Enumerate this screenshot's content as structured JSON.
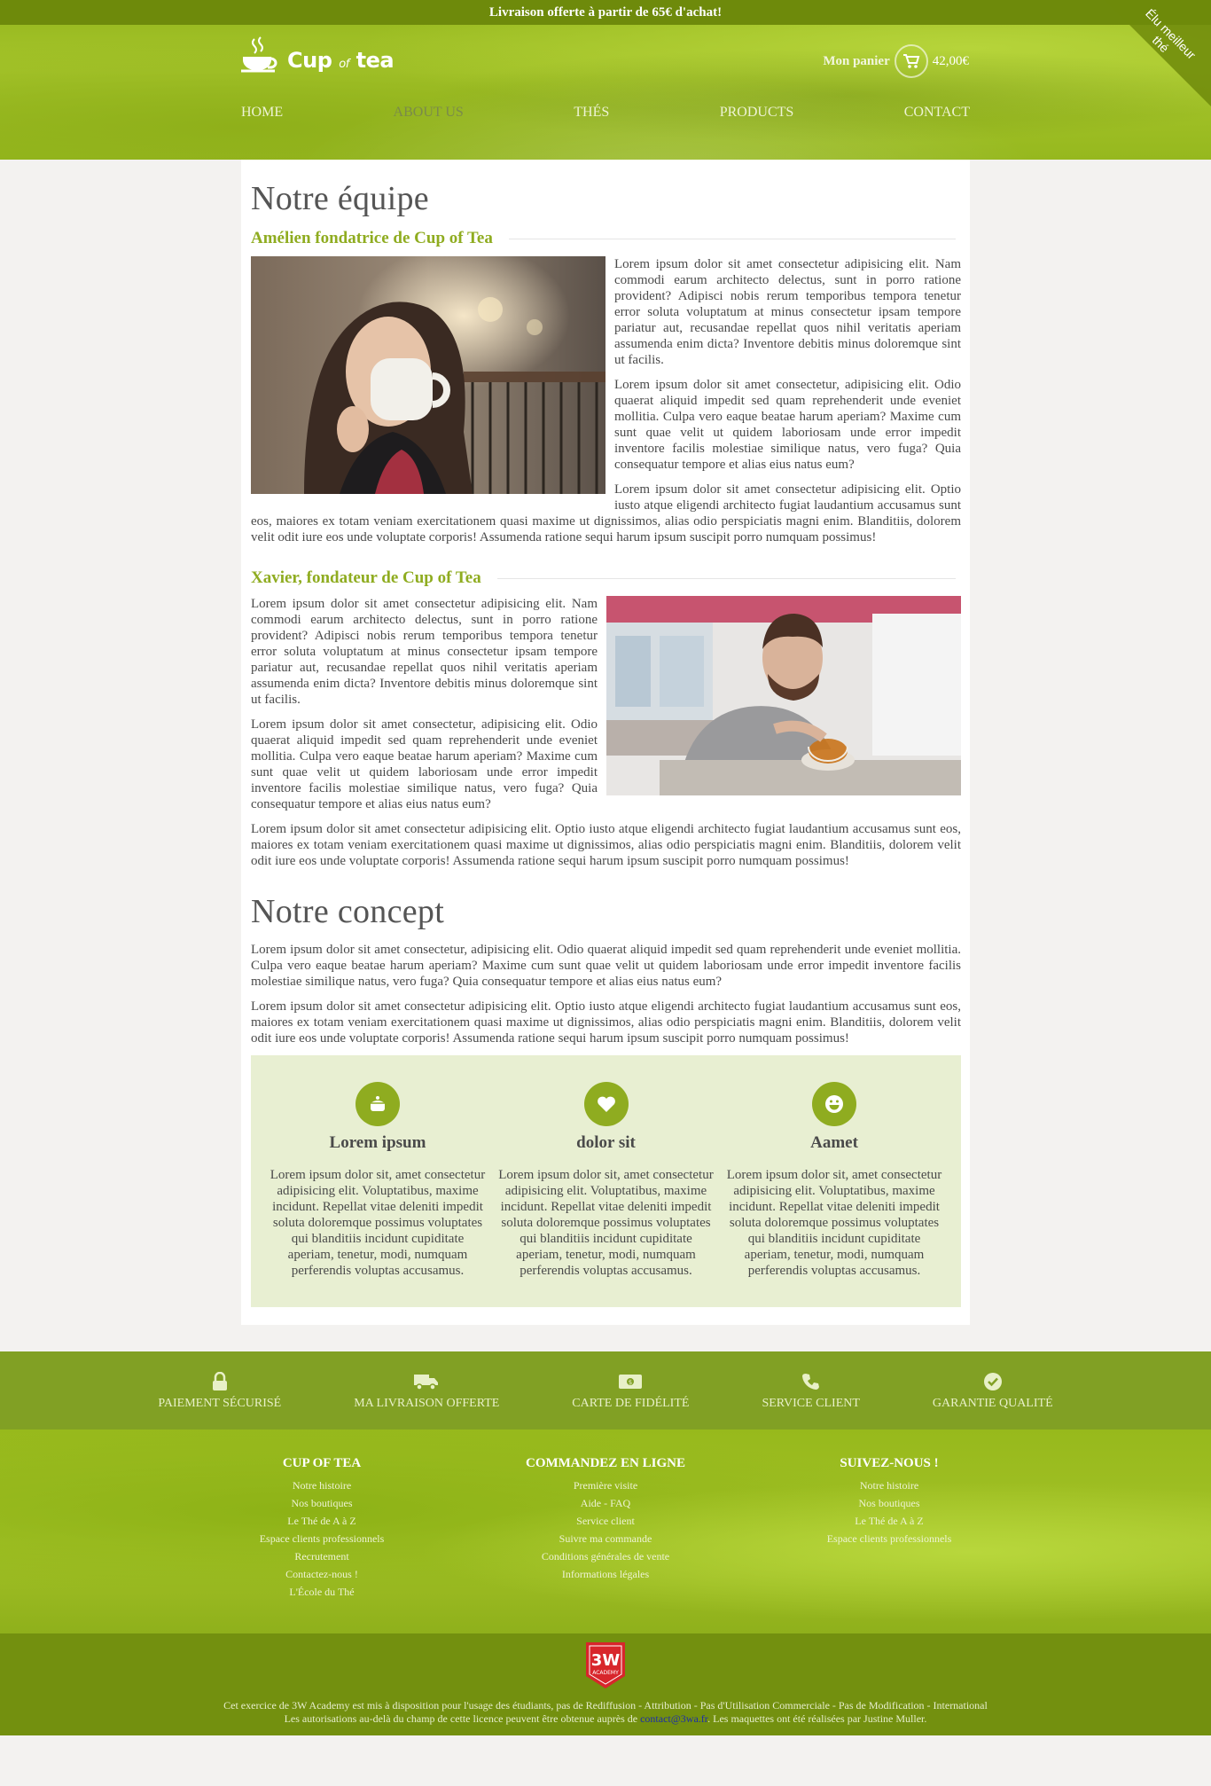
{
  "topbar": {
    "text": "Livraison offerte à partir de 65€ d'achat!"
  },
  "ribbon": {
    "text": "Élu meilleur thé"
  },
  "brand": {
    "name_main": "Cup",
    "name_of": "of",
    "name_tea": "tea"
  },
  "cart": {
    "label": "Mon panier",
    "total": "42,00€",
    "icon": "cart-icon"
  },
  "nav": {
    "items": [
      {
        "label": "HOME",
        "active": false
      },
      {
        "label": "ABOUT US",
        "active": true
      },
      {
        "label": "THÉS",
        "active": false
      },
      {
        "label": "PRODUCTS",
        "active": false
      },
      {
        "label": "CONTACT",
        "active": false
      }
    ]
  },
  "team": {
    "title": "Notre équipe",
    "members": [
      {
        "name": "Amélien fondatrice de Cup of Tea",
        "p1": "Lorem ipsum dolor sit amet consectetur adipisicing elit. Nam commodi earum architecto delectus, sunt in porro ratione provident? Adipisci nobis rerum temporibus tempora tenetur error soluta voluptatum at minus consectetur ipsam tempore pariatur aut, recusandae repellat quos nihil veritatis aperiam assumenda enim dicta? Inventore debitis minus doloremque sint ut facilis.",
        "p2": "Lorem ipsum dolor sit amet consectetur, adipisicing elit. Odio quaerat aliquid impedit sed quam reprehenderit unde eveniet mollitia. Culpa vero eaque beatae harum aperiam? Maxime cum sunt quae velit ut quidem laboriosam unde error impedit inventore facilis molestiae similique natus, vero fuga? Quia consequatur tempore et alias eius natus eum?",
        "p3": "Lorem ipsum dolor sit amet consectetur adipisicing elit. Optio iusto atque eligendi architecto fugiat laudantium accusamus sunt eos, maiores ex totam veniam exercitationem quasi maxime ut dignissimos, alias odio perspiciatis magni enim. Blanditiis, dolorem velit odit iure eos unde voluptate corporis! Assumenda ratione sequi harum ipsum suscipit porro numquam possimus!"
      },
      {
        "name": "Xavier, fondateur de Cup of Tea",
        "p1": "Lorem ipsum dolor sit amet consectetur adipisicing elit. Nam commodi earum architecto delectus, sunt in porro ratione provident? Adipisci nobis rerum temporibus tempora tenetur error soluta voluptatum at minus consectetur ipsam tempore pariatur aut, recusandae repellat quos nihil veritatis aperiam assumenda enim dicta? Inventore debitis minus doloremque sint ut facilis.",
        "p2": "Lorem ipsum dolor sit amet consectetur, adipisicing elit. Odio quaerat aliquid impedit sed quam reprehenderit unde eveniet mollitia. Culpa vero eaque beatae harum aperiam? Maxime cum sunt quae velit ut quidem laboriosam unde error impedit inventore facilis molestiae similique natus, vero fuga? Quia consequatur tempore et alias eius natus eum?",
        "p3": "Lorem ipsum dolor sit amet consectetur adipisicing elit. Optio iusto atque eligendi architecto fugiat laudantium accusamus sunt eos, maiores ex totam veniam exercitationem quasi maxime ut dignissimos, alias odio perspiciatis magni enim. Blanditiis, dolorem velit odit iure eos unde voluptate corporis! Assumenda ratione sequi harum ipsum suscipit porro numquam possimus!"
      }
    ]
  },
  "concept": {
    "title": "Notre concept",
    "p1": "Lorem ipsum dolor sit amet consectetur, adipisicing elit. Odio quaerat aliquid impedit sed quam reprehenderit unde eveniet mollitia. Culpa vero eaque beatae harum aperiam? Maxime cum sunt quae velit ut quidem laboriosam unde error impedit inventore facilis molestiae similique natus, vero fuga? Quia consequatur tempore et alias eius natus eum?",
    "p2": "Lorem ipsum dolor sit amet consectetur adipisicing elit. Optio iusto atque eligendi architecto fugiat laudantium accusamus sunt eos, maiores ex totam veniam exercitationem quasi maxime ut dignissimos, alias odio perspiciatis magni enim. Blanditiis, dolorem velit odit iure eos unde voluptate corporis! Assumenda ratione sequi harum ipsum suscipit porro numquam possimus!"
  },
  "features": [
    {
      "icon": "teapot-icon",
      "title": "Lorem ipsum",
      "text": "Lorem ipsum dolor sit, amet consectetur adipisicing elit. Voluptatibus, maxime incidunt. Repellat vitae deleniti impedit soluta doloremque possimus voluptates qui blanditiis incidunt cupiditate aperiam, tenetur, modi, numquam perferendis voluptas accusamus."
    },
    {
      "icon": "heart-icon",
      "title": "dolor sit",
      "text": "Lorem ipsum dolor sit, amet consectetur adipisicing elit. Voluptatibus, maxime incidunt. Repellat vitae deleniti impedit soluta doloremque possimus voluptates qui blanditiis incidunt cupiditate aperiam, tenetur, modi, numquam perferendis voluptas accusamus."
    },
    {
      "icon": "smiley-icon",
      "title": "Aamet",
      "text": "Lorem ipsum dolor sit, amet consectetur adipisicing elit. Voluptatibus, maxime incidunt. Repellat vitae deleniti impedit soluta doloremque possimus voluptates qui blanditiis incidunt cupiditate aperiam, tenetur, modi, numquam perferendis voluptas accusamus."
    }
  ],
  "services": [
    {
      "icon": "lock-icon",
      "label": "PAIEMENT SÉCURISÉ"
    },
    {
      "icon": "truck-icon",
      "label": "MA LIVRAISON OFFERTE"
    },
    {
      "icon": "money-icon",
      "label": "CARTE DE FIDÉLITÉ"
    },
    {
      "icon": "phone-icon",
      "label": "SERVICE CLIENT"
    },
    {
      "icon": "check-circle-icon",
      "label": "GARANTIE QUALITÉ"
    }
  ],
  "footer": {
    "columns": [
      {
        "title": "CUP OF TEA",
        "links": [
          "Notre histoire",
          "Nos boutiques",
          "Le Thé de A à Z",
          "Espace clients professionnels",
          "Recrutement",
          "Contactez-nous !",
          "L'École du Thé"
        ]
      },
      {
        "title": "COMMANDEZ EN LIGNE",
        "links": [
          "Première visite",
          "Aide - FAQ",
          "Service client",
          "Suivre ma commande",
          "Conditions générales de vente",
          "Informations légales"
        ]
      },
      {
        "title": "SUIVEZ-NOUS !",
        "links": [
          "Notre histoire",
          "Nos boutiques",
          "Le Thé de A à Z",
          "Espace clients professionnels"
        ]
      }
    ]
  },
  "bottom": {
    "logo_text": "3W",
    "logo_sub": "ACADEMY",
    "line1": "Cet exercice de 3W Academy est mis à disposition pour l'usage des étudiants, pas de Rediffusion - Attribution - Pas d'Utilisation Commerciale - Pas de Modification - International",
    "line2_a": "Les autorisations au-delà du champ de cette licence peuvent être obtenue auprès de",
    "email": "contact@3wa.fr",
    "line2_b": ". Les maquettes ont été réalisées par Justine Muller."
  },
  "colors": {
    "accent": "#8fac20",
    "header_green": "#a3c227",
    "topbar": "#6e8a0b",
    "services_bar": "#81a024",
    "features_bg": "#e8efd2"
  }
}
